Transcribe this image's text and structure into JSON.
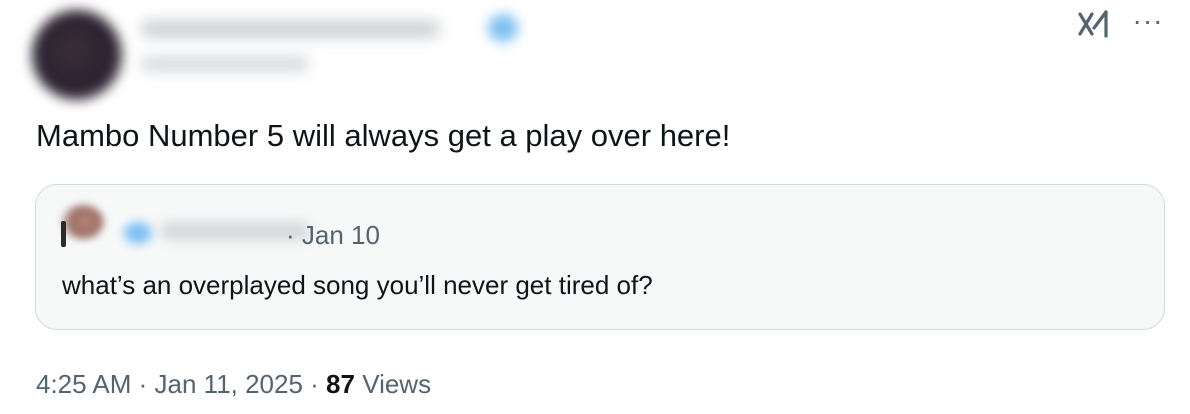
{
  "tweet": {
    "text": "Mambo Number 5 will always get a play over here!",
    "more_menu": "···",
    "quote": {
      "date": "· Jan 10",
      "text": "what’s an overplayed song you’ll never get tired of?"
    },
    "meta": {
      "time": "4:25 AM",
      "separator1": " · ",
      "date": "Jan 11, 2025",
      "separator2": " · ",
      "views_count": "87",
      "views_label": " Views"
    }
  },
  "icons": {
    "grok": "grok-icon",
    "more": "more-icon"
  },
  "colors": {
    "text_primary": "#0f1419",
    "text_secondary": "#536471",
    "border": "#cfd9de",
    "quote_background": "#f7f9f9",
    "verified_blue": "#1d9bf0"
  }
}
